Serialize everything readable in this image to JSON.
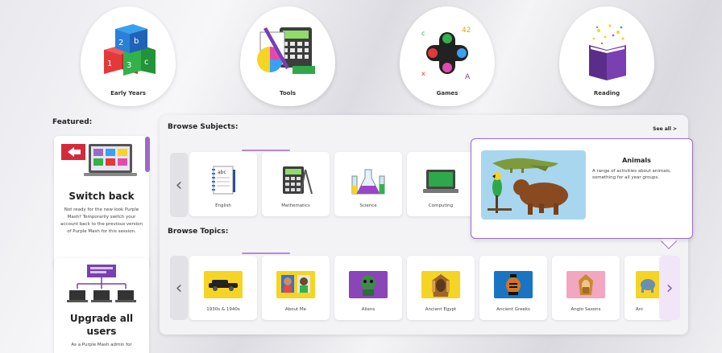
{
  "categories": [
    {
      "id": "early-years",
      "label": "Early Years"
    },
    {
      "id": "tools",
      "label": "Tools"
    },
    {
      "id": "games",
      "label": "Games"
    },
    {
      "id": "reading",
      "label": "Reading"
    }
  ],
  "featured": {
    "title": "Featured:",
    "switch_back": {
      "heading": "Switch back",
      "body": "Not ready for the new look Purple Mash? Temporarily switch your account back to the previous version of Purple Mash for this session."
    },
    "upgrade": {
      "heading_line1": "Upgrade all",
      "heading_line2": "users",
      "body": "As a Purple Mash admin for"
    }
  },
  "browse_subjects": {
    "title": "Browse Subjects:",
    "see_all": "See all >",
    "tiles": [
      {
        "label": "English",
        "icon": "notebook-icon"
      },
      {
        "label": "Mathematics",
        "icon": "calculator-icon"
      },
      {
        "label": "Science",
        "icon": "flask-icon"
      },
      {
        "label": "Computing",
        "icon": "laptop-icon"
      }
    ]
  },
  "browse_topics": {
    "title": "Browse Topics:",
    "tiles": [
      {
        "label": "1930s & 1940s",
        "icon": "vintage-car-icon",
        "color": "#f6d423"
      },
      {
        "label": "About Me",
        "icon": "people-icon",
        "color": "#f6d423"
      },
      {
        "label": "Aliens",
        "icon": "alien-icon",
        "color": "#8a45b8"
      },
      {
        "label": "Ancient Egypt",
        "icon": "pharaoh-icon",
        "color": "#f6d423"
      },
      {
        "label": "Ancient Greeks",
        "icon": "greek-vase-icon",
        "color": "#1a74c4"
      },
      {
        "label": "Anglo Saxons",
        "icon": "anglo-saxon-icon",
        "color": "#f2a6c0"
      },
      {
        "label": "Ani",
        "icon": "elephant-icon",
        "color": "#f6d423"
      }
    ]
  },
  "tooltip": {
    "title": "Animals",
    "description": "A range of activities about animals, something for all year groups."
  },
  "colors": {
    "accent": "#9b6ac7",
    "panel": "#f3f3f5"
  }
}
